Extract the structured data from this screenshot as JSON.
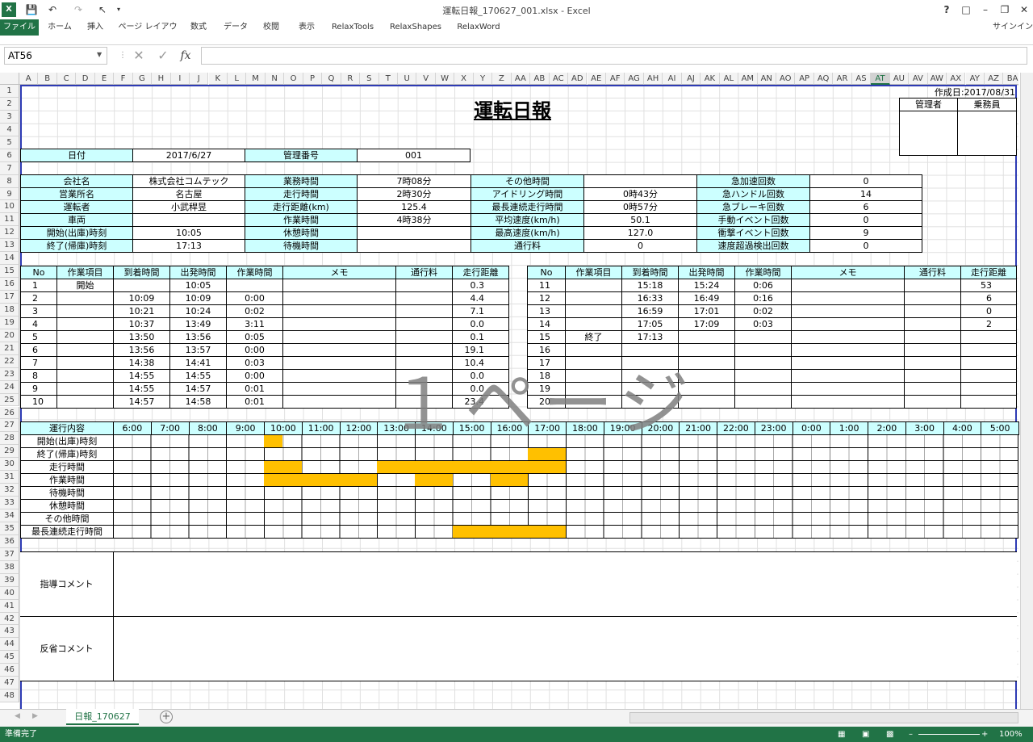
{
  "title_bar": {
    "document_title": "運転日報_170627_001.xlsx - Excel",
    "help": "?"
  },
  "ribbon": {
    "tabs": [
      "ファイル",
      "ホーム",
      "挿入",
      "ページ レイアウト",
      "数式",
      "データ",
      "校閲",
      "表示",
      "RelaxTools",
      "RelaxShapes",
      "RelaxWord"
    ],
    "signin": "サインイン"
  },
  "formula_bar": {
    "name_box": "AT56",
    "fx": "fx",
    "content": ""
  },
  "columns": [
    "A",
    "B",
    "C",
    "D",
    "E",
    "F",
    "G",
    "H",
    "I",
    "J",
    "K",
    "L",
    "M",
    "N",
    "O",
    "P",
    "Q",
    "R",
    "S",
    "T",
    "U",
    "V",
    "W",
    "X",
    "Y",
    "Z",
    "AA",
    "AB",
    "AC",
    "AD",
    "AE",
    "AF",
    "AG",
    "AH",
    "AI",
    "AJ",
    "AK",
    "AL",
    "AM",
    "AN",
    "AO",
    "AP",
    "AQ",
    "AR",
    "AS",
    "AT",
    "AU",
    "AV",
    "AW",
    "AX",
    "AY",
    "AZ",
    "BA"
  ],
  "selected_column": "AT",
  "rows": [
    "1",
    "2",
    "3",
    "4",
    "5",
    "6",
    "7",
    "8",
    "9",
    "10",
    "11",
    "12",
    "13",
    "14",
    "15",
    "16",
    "17",
    "18",
    "19",
    "20",
    "21",
    "22",
    "23",
    "24",
    "25",
    "26",
    "27",
    "28",
    "29",
    "30",
    "31",
    "32",
    "33",
    "34",
    "35",
    "36",
    "37",
    "38",
    "39",
    "40",
    "41",
    "42",
    "43",
    "44",
    "45",
    "46",
    "47",
    "48"
  ],
  "report": {
    "created": "作成日:2017/08/31",
    "title": "運転日報",
    "approval": [
      "管理者",
      "乗務員"
    ],
    "date_label": "日付",
    "date_value": "2017/6/27",
    "mgmt_label": "管理番号",
    "mgmt_value": "001",
    "info": [
      [
        "会社名",
        "株式会社コムテック",
        "業務時間",
        "7時08分",
        "その他時間",
        "",
        "急加速回数",
        "0"
      ],
      [
        "営業所名",
        "名古屋",
        "走行時間",
        "2時30分",
        "アイドリング時間",
        "0時43分",
        "急ハンドル回数",
        "14"
      ],
      [
        "運転者",
        "小武稈昱",
        "走行距離(km)",
        "125.4",
        "最長連続走行時間",
        "0時57分",
        "急ブレーキ回数",
        "6"
      ],
      [
        "車両",
        "",
        "作業時間",
        "4時38分",
        "平均速度(km/h)",
        "50.1",
        "手動イベント回数",
        "0"
      ],
      [
        "開始(出庫)時刻",
        "10:05",
        "休憩時間",
        "",
        "最高速度(km/h)",
        "127.0",
        "衝撃イベント回数",
        "9"
      ],
      [
        "終了(帰庫)時刻",
        "17:13",
        "待機時間",
        "",
        "通行料",
        "0",
        "速度超過検出回数",
        "0"
      ]
    ],
    "log_headers": [
      "No",
      "作業項目",
      "到着時間",
      "出発時間",
      "作業時間",
      "メモ",
      "通行料",
      "走行距離"
    ],
    "log_left": [
      [
        "1",
        "開始",
        "",
        "10:05",
        "",
        "",
        "",
        "0.3"
      ],
      [
        "2",
        "",
        "10:09",
        "10:09",
        "0:00",
        "",
        "",
        "4.4"
      ],
      [
        "3",
        "",
        "10:21",
        "10:24",
        "0:02",
        "",
        "",
        "7.1"
      ],
      [
        "4",
        "",
        "10:37",
        "13:49",
        "3:11",
        "",
        "",
        "0.0"
      ],
      [
        "5",
        "",
        "13:50",
        "13:56",
        "0:05",
        "",
        "",
        "0.1"
      ],
      [
        "6",
        "",
        "13:56",
        "13:57",
        "0:00",
        "",
        "",
        "19.1"
      ],
      [
        "7",
        "",
        "14:38",
        "14:41",
        "0:03",
        "",
        "",
        "10.4"
      ],
      [
        "8",
        "",
        "14:55",
        "14:55",
        "0:00",
        "",
        "",
        "0.0"
      ],
      [
        "9",
        "",
        "14:55",
        "14:57",
        "0:01",
        "",
        "",
        "0.0"
      ],
      [
        "10",
        "",
        "14:57",
        "14:58",
        "0:01",
        "",
        "",
        "23.4"
      ]
    ],
    "log_right": [
      [
        "11",
        "",
        "15:18",
        "15:24",
        "0:06",
        "",
        "",
        "53"
      ],
      [
        "12",
        "",
        "16:33",
        "16:49",
        "0:16",
        "",
        "",
        "6"
      ],
      [
        "13",
        "",
        "16:59",
        "17:01",
        "0:02",
        "",
        "",
        "0"
      ],
      [
        "14",
        "",
        "17:05",
        "17:09",
        "0:03",
        "",
        "",
        "2"
      ],
      [
        "15",
        "終了",
        "17:13",
        "",
        "",
        "",
        "",
        ""
      ],
      [
        "16",
        "",
        "",
        "",
        "",
        "",
        "",
        ""
      ],
      [
        "17",
        "",
        "",
        "",
        "",
        "",
        "",
        ""
      ],
      [
        "18",
        "",
        "",
        "",
        "",
        "",
        "",
        ""
      ],
      [
        "19",
        "",
        "",
        "",
        "",
        "",
        "",
        ""
      ],
      [
        "20",
        "",
        "",
        "",
        "",
        "",
        "",
        ""
      ]
    ],
    "timeline_label": "運行内容",
    "hours": [
      "6:00",
      "7:00",
      "8:00",
      "9:00",
      "10:00",
      "11:00",
      "12:00",
      "13:00",
      "14:00",
      "15:00",
      "16:00",
      "17:00",
      "18:00",
      "19:00",
      "20:00",
      "21:00",
      "22:00",
      "23:00",
      "0:00",
      "1:00",
      "2:00",
      "3:00",
      "4:00",
      "5:00"
    ],
    "timeline_rows": [
      "開始(出庫)時刻",
      "終了(帰庫)時刻",
      "走行時間",
      "作業時間",
      "待機時間",
      "休憩時間",
      "その他時間",
      "最長連続走行時間"
    ],
    "timeline_bars": [
      [
        [
          8,
          9
        ]
      ],
      [],
      [
        [
          8,
          10
        ],
        [
          14,
          22
        ],
        [
          22,
          24
        ]
      ],
      [
        [
          8,
          14
        ],
        [
          16,
          18
        ],
        [
          20,
          22
        ]
      ],
      [],
      [],
      [],
      [
        [
          18,
          24
        ]
      ]
    ],
    "timeline_bars_extra": {
      "row3_peak": [
        22,
        24
      ]
    },
    "guidance_label": "指導コメント",
    "reflection_label": "反省コメント",
    "watermark": "１ページ"
  },
  "sheet_tab": "日報_170627",
  "status": {
    "ready": "準備完了",
    "zoom": "100%"
  }
}
